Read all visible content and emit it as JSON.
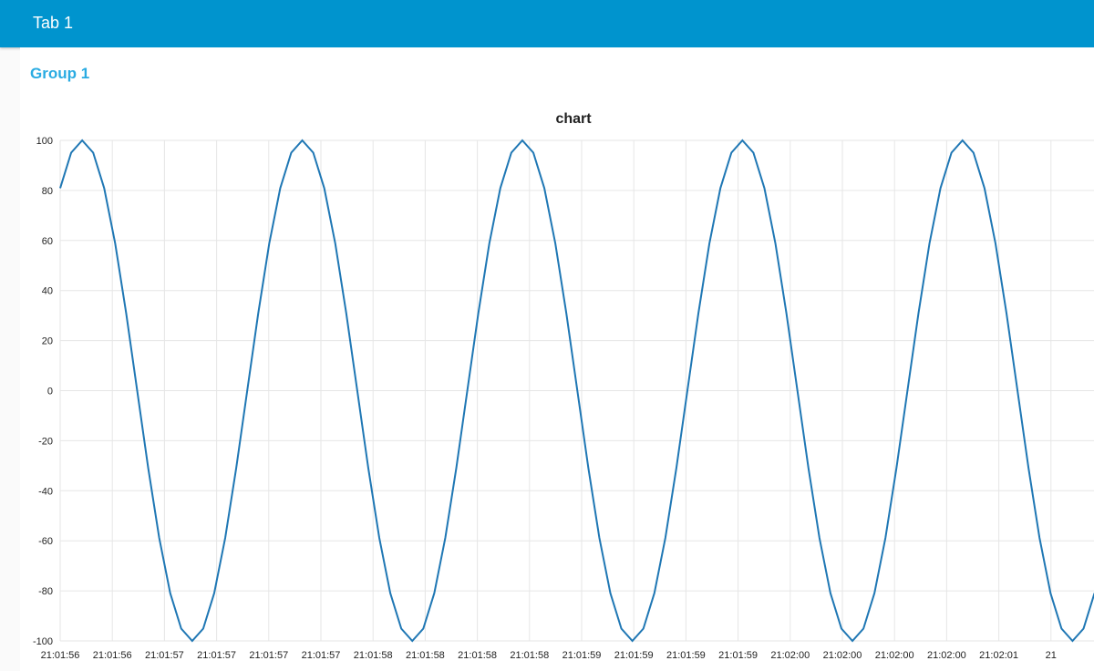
{
  "header": {
    "title": "Tab 1"
  },
  "group": {
    "title": "Group 1"
  },
  "colors": {
    "header_bg": "#0094ce",
    "group_title": "#29abe2",
    "series_line": "#1f77b4",
    "grid": "#e6e6e6"
  },
  "chart_data": {
    "type": "line",
    "title": "chart",
    "xlabel": "",
    "ylabel": "",
    "ylim": [
      -100,
      100
    ],
    "yticks": [
      100,
      80,
      60,
      40,
      20,
      0,
      -20,
      -40,
      -60,
      -80,
      -100
    ],
    "xticks": [
      "21:01:56",
      "21:01:56",
      "21:01:57",
      "21:01:57",
      "21:01:57",
      "21:01:57",
      "21:01:58",
      "21:01:58",
      "21:01:58",
      "21:01:58",
      "21:01:59",
      "21:01:59",
      "21:01:59",
      "21:01:59",
      "21:02:00",
      "21:02:00",
      "21:02:00",
      "21:02:00",
      "21:02:01",
      "21"
    ],
    "grid": true,
    "legend": "none",
    "series": [
      {
        "values": [
          80.9,
          95.1,
          100,
          95.1,
          80.9,
          58.8,
          30.9,
          0,
          -30.9,
          -58.8,
          -80.9,
          -95.1,
          -100,
          -95.1,
          -80.9,
          -58.8,
          -30.9,
          0,
          30.9,
          58.8,
          80.9,
          95.1,
          100,
          95.1,
          80.9,
          58.8,
          30.9,
          0,
          -30.9,
          -58.8,
          -80.9,
          -95.1,
          -100,
          -95.1,
          -80.9,
          -58.8,
          -30.9,
          0,
          30.9,
          58.8,
          80.9,
          95.1,
          100,
          95.1,
          80.9,
          58.8,
          30.9,
          0,
          -30.9,
          -58.8,
          -80.9,
          -95.1,
          -100,
          -95.1,
          -80.9,
          -58.8,
          -30.9,
          0,
          30.9,
          58.8,
          80.9,
          95.1,
          100,
          95.1,
          80.9,
          58.8,
          30.9,
          0,
          -30.9,
          -58.8,
          -80.9,
          -95.1,
          -100,
          -95.1,
          -80.9,
          -58.8,
          -30.9,
          0,
          30.9,
          58.8,
          80.9,
          95.1,
          100,
          95.1,
          80.9,
          58.8,
          30.9,
          0,
          -30.9,
          -58.8,
          -80.9,
          -95.1,
          -100,
          -95.1,
          -80.9
        ]
      }
    ]
  }
}
